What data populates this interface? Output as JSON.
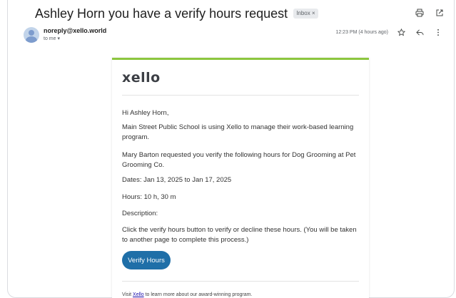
{
  "email": {
    "subject": "Ashley Horn you have a verify hours request",
    "label": "Inbox ×",
    "sender": "noreply@xello.world",
    "to": "to me ▾",
    "time": "12:23 PM (4 hours ago)"
  },
  "content": {
    "logo": "xello",
    "greeting": "Hi Ashley Horn,",
    "para1": "Main Street Public School is using Xello to manage their work-based learning program.",
    "para2": "Mary Barton requested you verify the following hours for Dog Grooming at Pet Grooming Co.",
    "dates": "Dates: Jan 13, 2025 to Jan 17, 2025",
    "hours": "Hours: 10 h, 30 m",
    "description": "Description:",
    "instructions": "Click the verify hours button to verify or decline these hours. (You will be taken to another page to complete this process.)",
    "button": "Verify Hours",
    "footer_pre": "Visit ",
    "footer_link": "Xello",
    "footer_post": " to learn more about our award-winning program."
  },
  "icons": {
    "print": "print-icon",
    "open": "open-in-new-window-icon",
    "star": "star-icon",
    "reply": "reply-icon",
    "more": "more-vert-icon"
  },
  "colors": {
    "accent_green": "#8cc63f",
    "button_blue": "#1f6fa8",
    "link": "#1a0dab"
  }
}
